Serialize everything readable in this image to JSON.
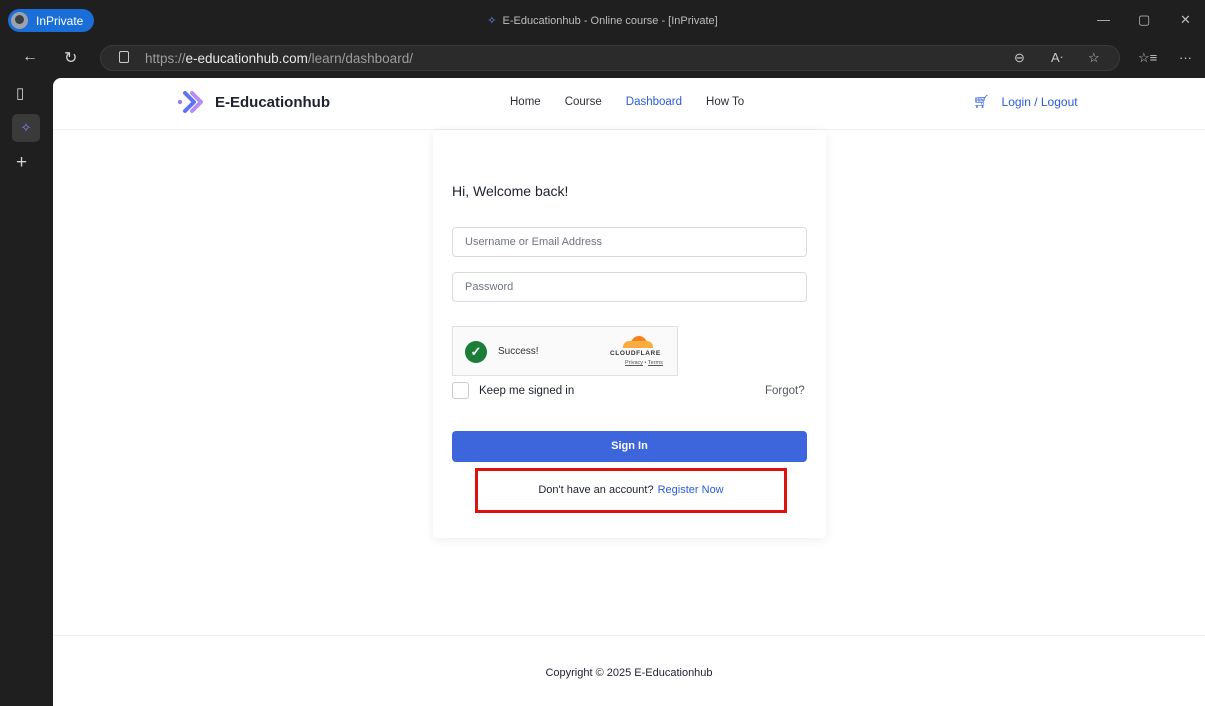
{
  "browser": {
    "inprivate_label": "InPrivate",
    "tab_title": "E-Educationhub - Online course - [InPrivate]",
    "url_prefix": "https://",
    "url_host": "e-educationhub.com",
    "url_path": "/learn/dashboard/"
  },
  "site": {
    "brand": "E-Educationhub",
    "nav": [
      {
        "label": "Home"
      },
      {
        "label": "Course"
      },
      {
        "label": "Dashboard",
        "active": true
      },
      {
        "label": "How To"
      }
    ],
    "login_logout": "Login / Logout"
  },
  "login": {
    "welcome": "Hi, Welcome back!",
    "username_placeholder": "Username or Email Address",
    "password_placeholder": "Password",
    "captcha_status": "Success!",
    "captcha_brand": "CLOUDFLARE",
    "captcha_privacy": "Privacy",
    "captcha_sep": " • ",
    "captcha_terms": "Terms",
    "keep_signed_in": "Keep me signed in",
    "forgot": "Forgot?",
    "sign_in": "Sign In",
    "no_account": "Don't have an account?",
    "register": "Register Now"
  },
  "footer": {
    "copyright": "Copyright © 2025 E-Educationhub"
  },
  "colors": {
    "accent": "#2a5bd7",
    "button": "#3e66dc",
    "highlight_border": "#e01010"
  }
}
